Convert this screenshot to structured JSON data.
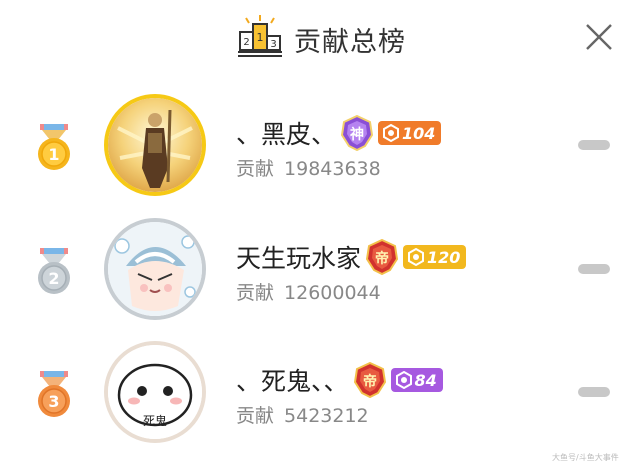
{
  "header": {
    "title": "贡献总榜",
    "icon": "podium-icon",
    "close_icon": "close-icon"
  },
  "leaderboard": [
    {
      "rank": "1",
      "medal_color": "#f5b51c",
      "name": "、黑皮、",
      "rank_badge_char": "神",
      "rank_badge_color": "#8a4fd6",
      "level": "104",
      "level_color": "#f07b2a",
      "contribution_label": "贡献",
      "contribution": "19843638"
    },
    {
      "rank": "2",
      "medal_color": "#b8c0c6",
      "name": "天生玩水家",
      "rank_badge_char": "帝",
      "rank_badge_color": "#d1322e",
      "level": "120",
      "level_color": "#f2b81e",
      "contribution_label": "贡献",
      "contribution": "12600044"
    },
    {
      "rank": "3",
      "medal_color": "#f08a3c",
      "name": "、死鬼、、",
      "rank_badge_char": "帝",
      "rank_badge_color": "#d1322e",
      "level": "84",
      "level_color": "#a659e0",
      "contribution_label": "贡献",
      "contribution": "5423212"
    }
  ],
  "avatar3_caption": "死鬼",
  "watermark": "大鱼号/斗鱼大事件"
}
